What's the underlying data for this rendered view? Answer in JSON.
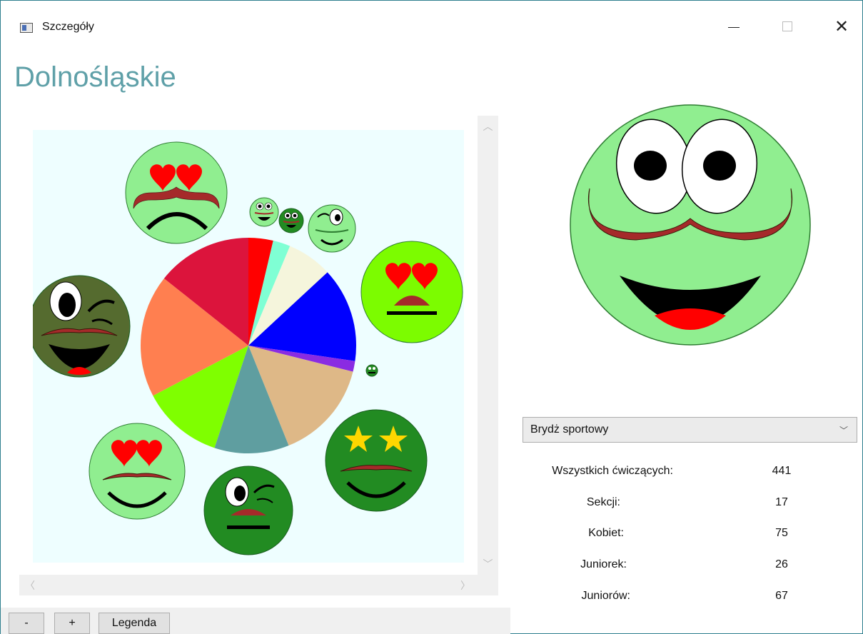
{
  "window": {
    "title": "Szczegóły",
    "controls": {
      "minimize_icon": "minimize-icon",
      "maximize_icon": "maximize-icon",
      "close_icon": "close-icon"
    }
  },
  "page": {
    "heading": "Dolnośląskie"
  },
  "scrollbars": {
    "up_icon": "chevron-up-icon",
    "down_icon": "chevron-down-icon",
    "left_icon": "chevron-left-icon",
    "right_icon": "chevron-right-icon"
  },
  "chart_data": {
    "type": "pie",
    "background": "#eefeff",
    "slices": [
      {
        "color": "#ff0000",
        "value": 3.7
      },
      {
        "color": "#7fffd4",
        "value": 2.6
      },
      {
        "color": "#f5f5dc",
        "value": 6.8
      },
      {
        "color": "#0000ff",
        "value": 14.2
      },
      {
        "color": "#8a2be2",
        "value": 1.6
      },
      {
        "color": "#deb887",
        "value": 15.0
      },
      {
        "color": "#5f9ea0",
        "value": 11.2
      },
      {
        "color": "#7fff00",
        "value": 12.2
      },
      {
        "color": "#ff7f50",
        "value": 18.4
      },
      {
        "color": "#dc143c",
        "value": 14.3
      }
    ],
    "faces": [
      {
        "name": "face-top-left-hearts",
        "fill": "#90ee90",
        "eyes": "hearts",
        "mouth": "frown"
      },
      {
        "name": "face-tiny-1",
        "fill": "#90ee90",
        "eyes": "round",
        "mouth": "open"
      },
      {
        "name": "face-tiny-2",
        "fill": "#228b22",
        "eyes": "round",
        "mouth": "open"
      },
      {
        "name": "face-small-wink",
        "fill": "#90ee90",
        "eyes": "wink",
        "mouth": "smile"
      },
      {
        "name": "face-right-hearts",
        "fill": "#7cfc00",
        "eyes": "hearts",
        "mouth": "flat"
      },
      {
        "name": "face-dot",
        "fill": "#228b22",
        "eyes": "round",
        "mouth": "flat"
      },
      {
        "name": "face-stars",
        "fill": "#228b22",
        "eyes": "stars",
        "mouth": "smile"
      },
      {
        "name": "face-bottom-wink",
        "fill": "#228b22",
        "eyes": "wink",
        "mouth": "flat"
      },
      {
        "name": "face-bottom-left-hearts",
        "fill": "#90ee90",
        "eyes": "hearts",
        "mouth": "smile"
      },
      {
        "name": "face-left-dark-wink",
        "fill": "#556b2f",
        "eyes": "wink",
        "mouth": "open"
      }
    ]
  },
  "big_face": {
    "fill": "#90ee90",
    "mustache": "#a52a2a",
    "tongue": "#ff0000"
  },
  "toolbar": {
    "minus_label": "-",
    "plus_label": "+",
    "legend_label": "Legenda"
  },
  "details": {
    "discipline_select": {
      "value": "Brydż sportowy",
      "arrow_icon": "chevron-down-icon"
    },
    "stats": [
      {
        "label": "Wszystkich ćwiczących:",
        "value": "441"
      },
      {
        "label": "Sekcji:",
        "value": "17"
      },
      {
        "label": "Kobiet:",
        "value": "75"
      },
      {
        "label": "Juniorek:",
        "value": "26"
      },
      {
        "label": "Juniorów:",
        "value": "67"
      }
    ]
  }
}
